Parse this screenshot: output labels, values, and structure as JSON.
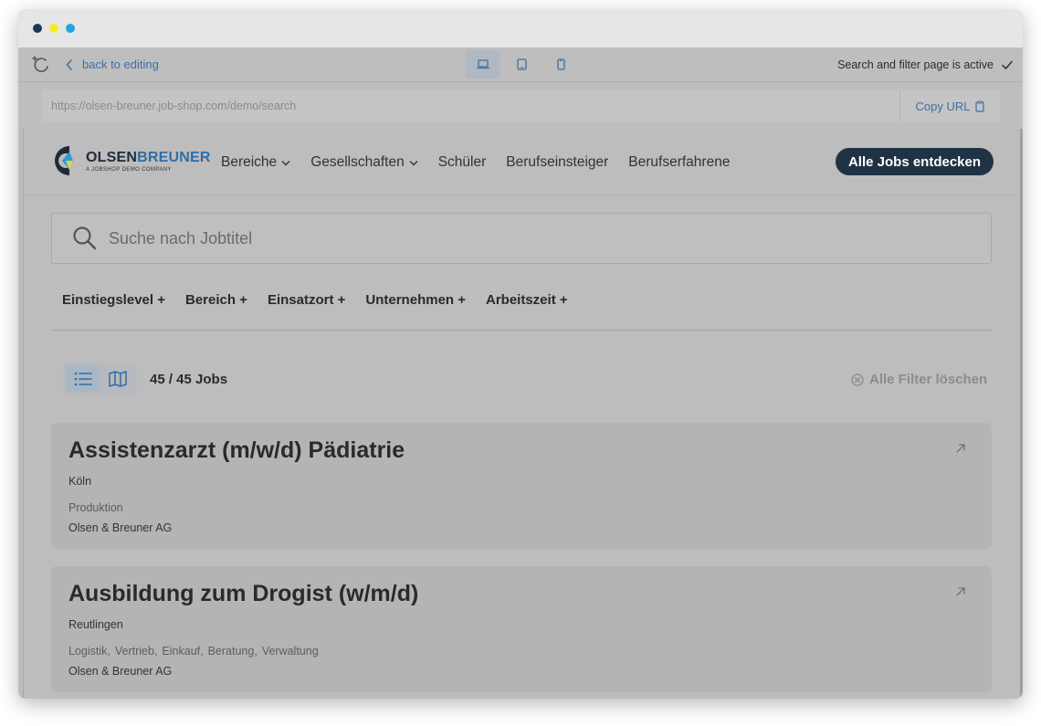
{
  "toolbar": {
    "back_label": "back to editing",
    "status_text": "Search and filter page is active"
  },
  "urlbar": {
    "url": "https://olsen-breuner.job-shop.com/demo/search",
    "copy_label": "Copy URL"
  },
  "site": {
    "logo_part1": "OLSEN",
    "logo_part2": "BREUNER",
    "logo_sub": "A JOBSHOP DEMO COMPANY",
    "nav": [
      {
        "label": "Bereiche",
        "dropdown": true
      },
      {
        "label": "Gesellschaften",
        "dropdown": true
      },
      {
        "label": "Schüler",
        "dropdown": false
      },
      {
        "label": "Berufseinsteiger",
        "dropdown": false
      },
      {
        "label": "Berufserfahrene",
        "dropdown": false
      }
    ],
    "cta_label": "Alle Jobs entdecken"
  },
  "search": {
    "placeholder": "Suche nach Jobtitel"
  },
  "filters": [
    {
      "label": "Einstiegslevel +"
    },
    {
      "label": "Bereich +"
    },
    {
      "label": "Einsatzort +"
    },
    {
      "label": "Unternehmen +"
    },
    {
      "label": "Arbeitszeit +"
    }
  ],
  "results": {
    "count_label": "45 / 45 Jobs",
    "clear_label": "Alle Filter löschen"
  },
  "jobs": [
    {
      "title": "Assistenzarzt (m/w/d) Pädiatrie",
      "location": "Köln",
      "categories": [
        "Produktion"
      ],
      "company": "Olsen & Breuner AG"
    },
    {
      "title": "Ausbildung zum Drogist (w/m/d)",
      "location": "Reutlingen",
      "categories": [
        "Logistik,",
        "Vertrieb,",
        "Einkauf,",
        "Beratung,",
        "Verwaltung"
      ],
      "company": "Olsen & Breuner AG"
    }
  ],
  "colors": {
    "accent_link": "#3e6fa3",
    "cta_bg": "#1f3344",
    "logo_blue": "#2e6ea6",
    "logo_dark": "#1f2b3a"
  }
}
